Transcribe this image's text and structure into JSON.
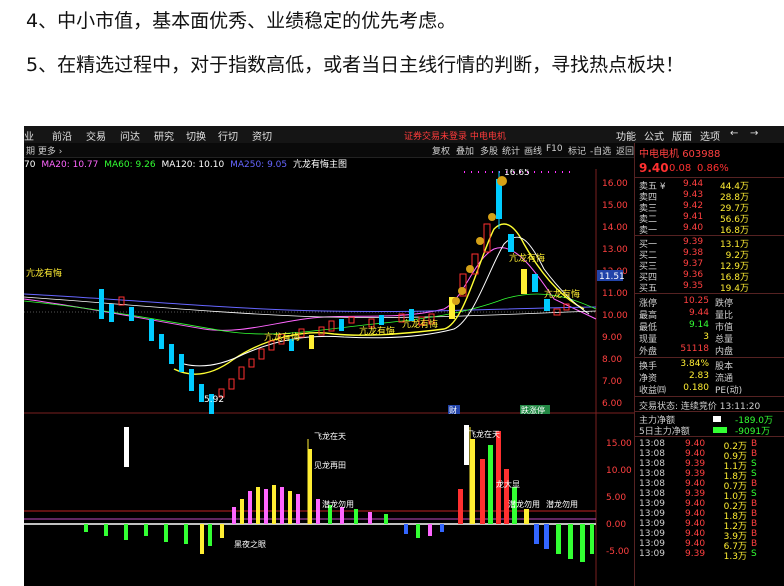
{
  "article": {
    "line4": "4、中小市值，基本面优秀、业绩稳定的优先考虑。",
    "line5": "5、在精选过程中，对于指数高低，或者当日主线行情的判断，寻找热点板块！"
  },
  "menu": {
    "items": [
      "业",
      "前沿",
      "交易",
      "问达",
      "研究",
      "切换",
      "行切",
      "资切"
    ],
    "warning": "证券交易未登录 中电电机",
    "right_items": [
      "功能",
      "公式",
      "版面",
      "选项",
      "←",
      "→"
    ]
  },
  "toolbar": {
    "left_label": "期 更多 ›",
    "buttons": [
      "复权",
      "叠加",
      "多股",
      "统计",
      "画线",
      "F10",
      "标记",
      "-自选",
      "返回"
    ]
  },
  "legend": {
    "items": [
      {
        "text": "70",
        "color": "#ffffff"
      },
      {
        "text": "MA20: 10.77",
        "color": "#ff66ff"
      },
      {
        "text": "MA60: 9.26",
        "color": "#33ff33"
      },
      {
        "text": "MA120: 10.10",
        "color": "#ffffff"
      },
      {
        "text": "MA250: 9.05",
        "color": "#6666ff"
      },
      {
        "text": "亢龙有悔主图",
        "color": "#ffffff"
      }
    ]
  },
  "main_chart": {
    "y_ticks": [
      "16.00",
      "15.00",
      "14.00",
      "13.00",
      "12.00",
      "11.00",
      "10.00",
      "9.00",
      "8.00",
      "7.00",
      "6.00"
    ],
    "current_price_tag": "11.51",
    "high_label": "16.65",
    "low_label": "5.92",
    "annotations": [
      "亢龙有悔",
      "亢龙有悔",
      "亢龙有悔",
      "亢龙有悔",
      "亢龙有悔",
      "亢龙有悔"
    ],
    "bottom_tags": [
      "财",
      "跌涨停"
    ]
  },
  "sub_chart": {
    "y_ticks": [
      "15.00",
      "10.00",
      "5.00",
      "0.00",
      "-5.00"
    ],
    "annotations": [
      "飞龙在天",
      "见龙再田",
      "潜龙勿用",
      "黑夜之眼",
      "飞龙在天",
      "龙大显",
      "潜龙勿用",
      "潜龙勿用"
    ]
  },
  "quote": {
    "name": "中电电机",
    "code": "603988",
    "price": "9.40",
    "change": "0.08",
    "pct": "0.86%",
    "asks": [
      {
        "label": "卖五 ¥",
        "price": "9.44",
        "vol": "44.4万"
      },
      {
        "label": "卖四",
        "price": "9.43",
        "vol": "28.8万"
      },
      {
        "label": "卖三",
        "price": "9.42",
        "vol": "29.7万"
      },
      {
        "label": "卖二",
        "price": "9.41",
        "vol": "56.6万"
      },
      {
        "label": "卖一",
        "price": "9.40",
        "vol": "16.8万"
      }
    ],
    "bids": [
      {
        "label": "买一",
        "price": "9.39",
        "vol": "13.1万"
      },
      {
        "label": "买二",
        "price": "9.38",
        "vol": "9.2万"
      },
      {
        "label": "买三",
        "price": "9.37",
        "vol": "12.9万"
      },
      {
        "label": "买四",
        "price": "9.36",
        "vol": "16.8万"
      },
      {
        "label": "买五",
        "price": "9.35",
        "vol": "19.4万"
      }
    ],
    "stats": [
      {
        "l1": "涨停",
        "v1": "10.25",
        "c1": "#ff4040",
        "l2": "跌停"
      },
      {
        "l1": "最高",
        "v1": "9.44",
        "c1": "#ff4040",
        "l2": "量比"
      },
      {
        "l1": "最低",
        "v1": "9.14",
        "c1": "#33ff33",
        "l2": "市值"
      },
      {
        "l1": "现量",
        "v1": "3",
        "c1": "#ffee33",
        "l2": "总量"
      },
      {
        "l1": "外盘",
        "v1": "51118",
        "c1": "#ff4040",
        "l2": "内盘"
      },
      {
        "l1": "换手",
        "v1": "3.84%",
        "c1": "#ffee33",
        "l2": "股本"
      },
      {
        "l1": "净资",
        "v1": "2.83",
        "c1": "#ffee33",
        "l2": "流通"
      },
      {
        "l1": "收益㈣",
        "v1": "0.180",
        "c1": "#ffee33",
        "l2": "PE(动)"
      }
    ],
    "status": "交易状态: 连续竞价 13:11:20",
    "flow": [
      {
        "label": "主力净额",
        "value": "-189.0万"
      },
      {
        "label": "5日主力净额",
        "value": "-9091万"
      }
    ],
    "ticks": [
      {
        "t": "13:08",
        "p": "9.40",
        "v": "0.2万",
        "f": "B"
      },
      {
        "t": "13:08",
        "p": "9.40",
        "v": "0.9万",
        "f": "B"
      },
      {
        "t": "13:08",
        "p": "9.39",
        "v": "1.1万",
        "f": "S"
      },
      {
        "t": "13:08",
        "p": "9.39",
        "v": "1.8万",
        "f": "S"
      },
      {
        "t": "13:08",
        "p": "9.40",
        "v": "0.7万",
        "f": "B"
      },
      {
        "t": "13:08",
        "p": "9.39",
        "v": "1.0万",
        "f": "S"
      },
      {
        "t": "13:09",
        "p": "9.40",
        "v": "0.2万",
        "f": "B"
      },
      {
        "t": "13:09",
        "p": "9.40",
        "v": "1.8万",
        "f": "B"
      },
      {
        "t": "13:09",
        "p": "9.40",
        "v": "1.2万",
        "f": "B"
      },
      {
        "t": "13:09",
        "p": "9.40",
        "v": "3.9万",
        "f": "B"
      },
      {
        "t": "13:09",
        "p": "9.40",
        "v": "6.7万",
        "f": "B"
      },
      {
        "t": "13:09",
        "p": "9.39",
        "v": "1.3万",
        "f": "S"
      }
    ]
  }
}
